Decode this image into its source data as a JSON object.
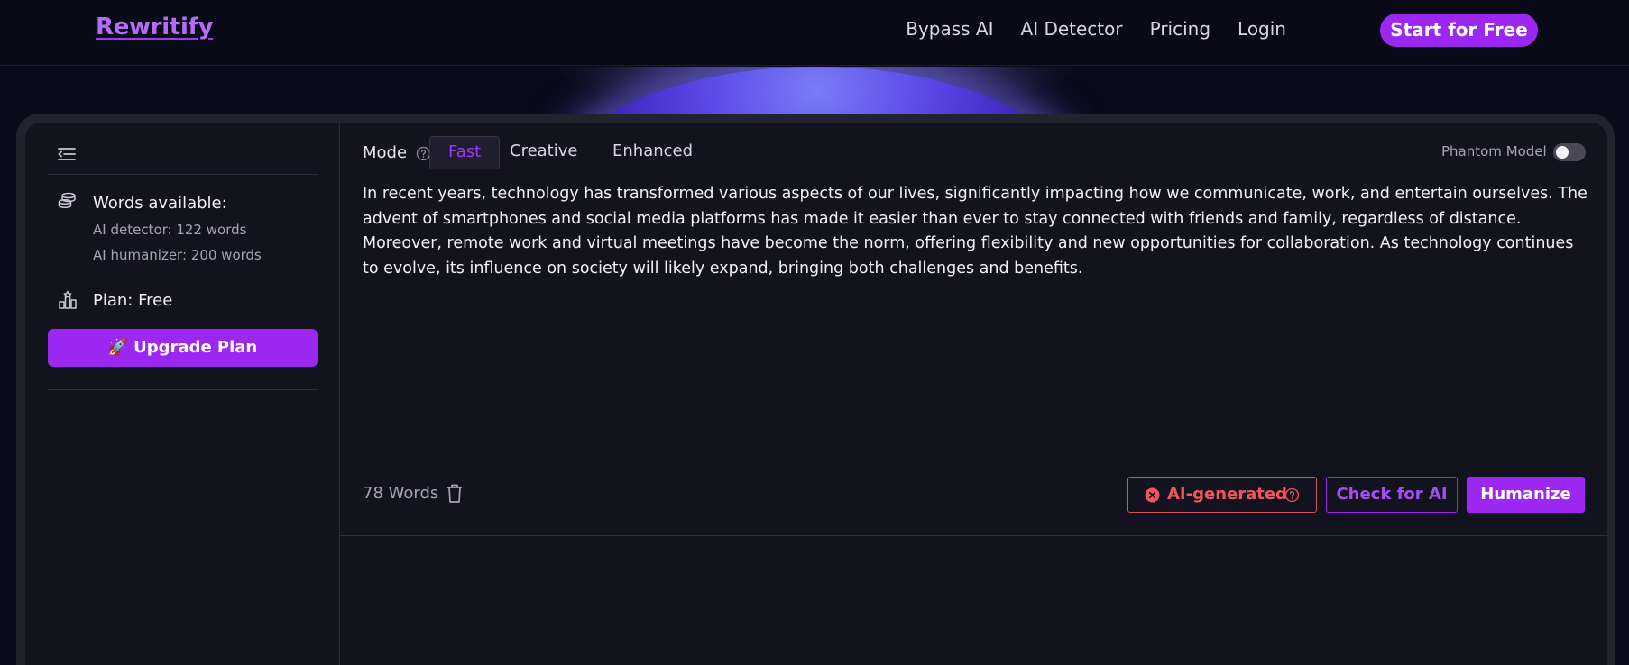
{
  "brand": {
    "logo": "Rewritify"
  },
  "nav": {
    "links": [
      "Bypass AI",
      "AI Detector",
      "Pricing",
      "Login"
    ],
    "cta": "Start for Free"
  },
  "sidebar": {
    "words_title": "Words available:",
    "ai_detector_words": "AI detector: 122 words",
    "ai_humanizer_words": "AI humanizer: 200 words",
    "plan": "Plan: Free",
    "upgrade_label": "Upgrade Plan",
    "upgrade_icon": "🚀"
  },
  "editor": {
    "mode_label": "Mode",
    "tabs": [
      "Fast",
      "Creative",
      "Enhanced"
    ],
    "active_tab": "Fast",
    "phantom_label": "Phantom Model",
    "phantom_enabled": false,
    "text": "In recent years, technology has transformed various aspects of our lives, significantly impacting how we communicate, work, and entertain ourselves. The advent of smartphones and social media platforms has made it easier than ever to stay connected with friends and family, regardless of distance. Moreover, remote work and virtual meetings have become the norm, offering flexibility and new opportunities for collaboration. As technology continues to evolve, its influence on society will likely expand, bringing both challenges and benefits.",
    "word_count": "78 Words",
    "ai_status": "AI-generated",
    "check_label": "Check for AI",
    "humanize_label": "Humanize"
  },
  "colors": {
    "accent": "#9b27f0",
    "danger": "#f2555c",
    "background": "#0b0a1c",
    "panel": "#13121f"
  }
}
